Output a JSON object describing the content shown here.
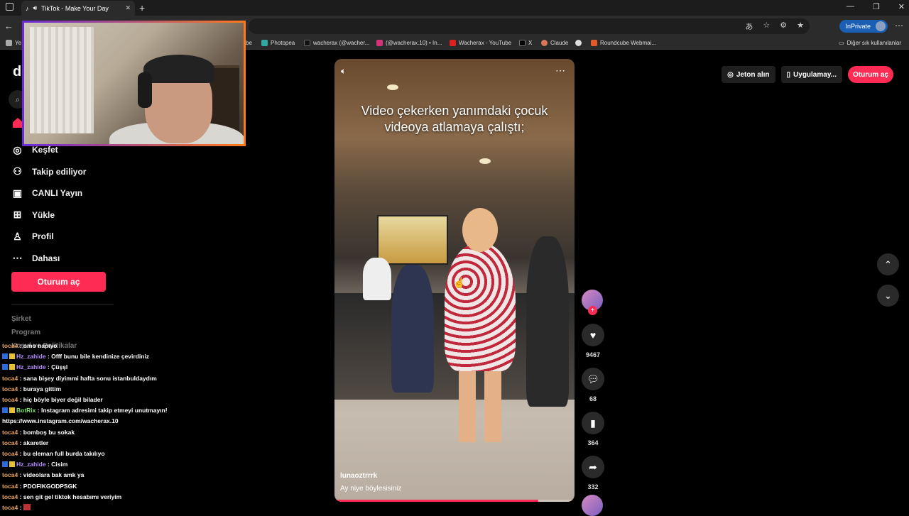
{
  "browser": {
    "tab_title": "TikTok - Make Your Day",
    "inprivate_label": "InPrivate",
    "bookmarks": [
      {
        "label": "Ye"
      },
      {
        "label": "be"
      },
      {
        "label": "Photopea"
      },
      {
        "label": "wacherax (@wacher..."
      },
      {
        "label": "(@wacherax.10) • In..."
      },
      {
        "label": "Wacherax - YouTube"
      },
      {
        "label": "X"
      },
      {
        "label": "Claude"
      },
      {
        "label": "Roundcube Webmai..."
      },
      {
        "label": "Diğer sık kullanılanlar"
      }
    ]
  },
  "sidebar": {
    "logo": "d",
    "items": [
      {
        "label": "Keşfet",
        "icon": "compass-icon"
      },
      {
        "label": "Takip ediliyor",
        "icon": "user-follow-icon"
      },
      {
        "label": "CANLI Yayın",
        "icon": "live-icon"
      },
      {
        "label": "Yükle",
        "icon": "plus-square-icon"
      },
      {
        "label": "Profil",
        "icon": "person-icon"
      },
      {
        "label": "Dahası",
        "icon": "ellipsis-icon"
      }
    ],
    "login_label": "Oturum aç",
    "footer": [
      "Şirket",
      "Program",
      "Koşul ve Politikalar"
    ]
  },
  "chat": [
    {
      "user": "toca4",
      "text": "omo napıyo",
      "color": "orange"
    },
    {
      "user": "Hz_zahide",
      "text": "Offf bunu bile kendinize çevirdiniz",
      "color": "purple",
      "badge": true
    },
    {
      "user": "Hz_zahide",
      "text": "Çüşşl",
      "color": "purple",
      "badge": true
    },
    {
      "user": "toca4",
      "text": "sana bişey diyimmi hafta sonu istanbuldaydım",
      "color": "orange"
    },
    {
      "user": "toca4",
      "text": "buraya gittim",
      "color": "orange"
    },
    {
      "user": "toca4",
      "text": "hiç böyle biyer değil bilader",
      "color": "orange"
    },
    {
      "user": "BotRix",
      "text": "Instagram adresimi takip etmeyi unutmayın!",
      "color": "green",
      "badge": true
    },
    {
      "user": "",
      "text": "https://www.instagram.com/wacherax.10",
      "color": "none"
    },
    {
      "user": "toca4",
      "text": "bomboş bu sokak",
      "color": "orange"
    },
    {
      "user": "toca4",
      "text": "akaretler",
      "color": "orange"
    },
    {
      "user": "toca4",
      "text": "bu eleman full burda takılıyo",
      "color": "orange"
    },
    {
      "user": "Hz_zahide",
      "text": "Cisim",
      "color": "purple",
      "badge": true
    },
    {
      "user": "toca4",
      "text": "videolara bak amk ya",
      "color": "orange"
    },
    {
      "user": "toca4",
      "text": "PDOFIKGODPSGK",
      "color": "orange"
    },
    {
      "user": "toca4",
      "text": "sen git gel tiktok hesabımı veriyim",
      "color": "orange"
    },
    {
      "user": "toca4",
      "text": "",
      "color": "orange",
      "emote": true
    }
  ],
  "video": {
    "caption": "Video çekerken yanımdaki çocuk videoya atlamaya çalıştı;",
    "author": "lunaoztrrrk",
    "description": "Ay niye böylesisiniz",
    "progress": 0.85
  },
  "actions": {
    "likes": "9467",
    "comments": "68",
    "saves": "364",
    "shares": "332"
  },
  "topbar": {
    "coins_label": "Jeton alın",
    "app_label": "Uygulamay...",
    "login_label": "Oturum aç"
  },
  "colors": {
    "accent": "#fe2c55",
    "chat_orange": "#e8a35c",
    "chat_purple": "#b48cff",
    "chat_green": "#7ee36b"
  }
}
